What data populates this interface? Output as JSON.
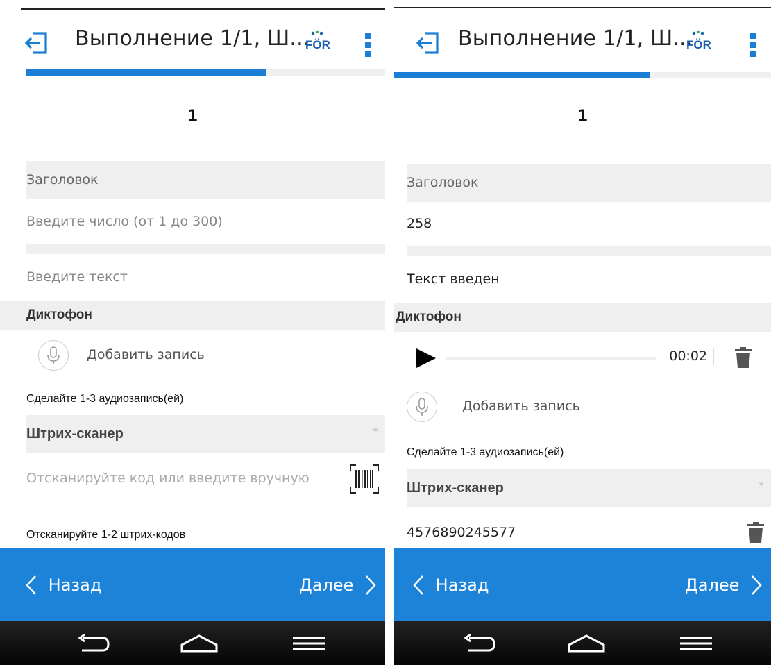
{
  "screens": [
    {
      "title": "Выполнение 1/1, Ш...",
      "progress": 0.67,
      "page_number": "1",
      "header_label": "Заголовок",
      "number_input_placeholder": "Введите число (от 1 до 300)",
      "text_input_placeholder": "Введите текст",
      "recorder_title": "Диктофон",
      "add_record_label": "Добавить запись",
      "audio_hint": "Сделайте 1-3 аудиозапись(ей)",
      "scanner_title": "Штрих-сканер",
      "scanner_required": "*",
      "scanner_placeholder": "Отсканируйте код или введите вручную",
      "scanner_hint": "Отсканируйте 1-2 штрих-кодов",
      "back_label": "Назад",
      "next_label": "Далее"
    },
    {
      "title": "Выполнение 1/1, Ш...",
      "progress": 0.68,
      "page_number": "1",
      "header_label": "Заголовок",
      "number_value": "258",
      "text_value": "Текст введен",
      "recorder_required": "*",
      "recorder_title": "Диктофон",
      "audio_time": "00:02",
      "add_record_label": "Добавить запись",
      "audio_hint": "Сделайте 1-3 аудиозапись(ей)",
      "scanner_title": "Штрих-сканер",
      "scanner_required": "*",
      "scanner_value": "4576890245577",
      "back_label": "Назад",
      "next_label": "Далее"
    }
  ],
  "colors": {
    "accent": "#1c83d8",
    "progress": "#1a7fd4",
    "logo_blue": "#1b5fb0",
    "logo_green": "#4cb050"
  },
  "icons": [
    "exit-icon",
    "for-logo",
    "overflow-menu-icon",
    "mic-icon",
    "barcode-icon",
    "trash-icon",
    "play-icon",
    "chevron-left-icon",
    "chevron-right-icon",
    "sys-back-icon",
    "sys-home-icon",
    "sys-menu-icon"
  ]
}
